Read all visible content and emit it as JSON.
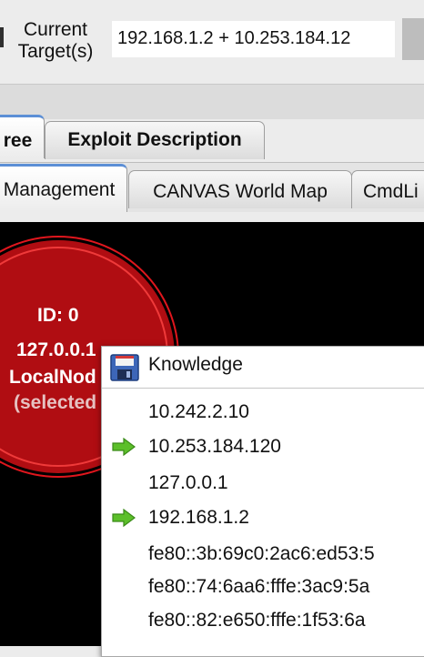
{
  "target": {
    "label": "Current\nTarget(s)",
    "value": "192.168.1.2 + 10.253.184.12"
  },
  "tabs_row1": [
    {
      "label": "ree",
      "active": true
    },
    {
      "label": "Exploit Description",
      "active": false
    }
  ],
  "tabs_row2": [
    {
      "label": "Management",
      "active": true
    },
    {
      "label": "CANVAS World Map",
      "active": false
    },
    {
      "label": "CmdLi",
      "active": false
    }
  ],
  "node": {
    "id": "ID: 0",
    "ip": "127.0.0.1",
    "name": "LocalNod",
    "status": "(selected"
  },
  "menu": {
    "title": "Knowledge",
    "icon": "floppy-disk-icon",
    "items": [
      {
        "label": "10.242.2.10",
        "targeted": false
      },
      {
        "label": "10.253.184.120",
        "targeted": true
      },
      {
        "label": "127.0.0.1",
        "targeted": false
      },
      {
        "label": "192.168.1.2",
        "targeted": true
      },
      {
        "label": "fe80::3b:69c0:2ac6:ed53:5",
        "targeted": false
      },
      {
        "label": "fe80::74:6aa6:fffe:3ac9:5a",
        "targeted": false
      },
      {
        "label": "fe80::82:e650:fffe:1f53:6a",
        "targeted": false
      }
    ]
  },
  "colors": {
    "node_fill": "#b00d12",
    "target_arrow": "#5cbf2a",
    "active_tab_accent": "#5c8fd6"
  }
}
